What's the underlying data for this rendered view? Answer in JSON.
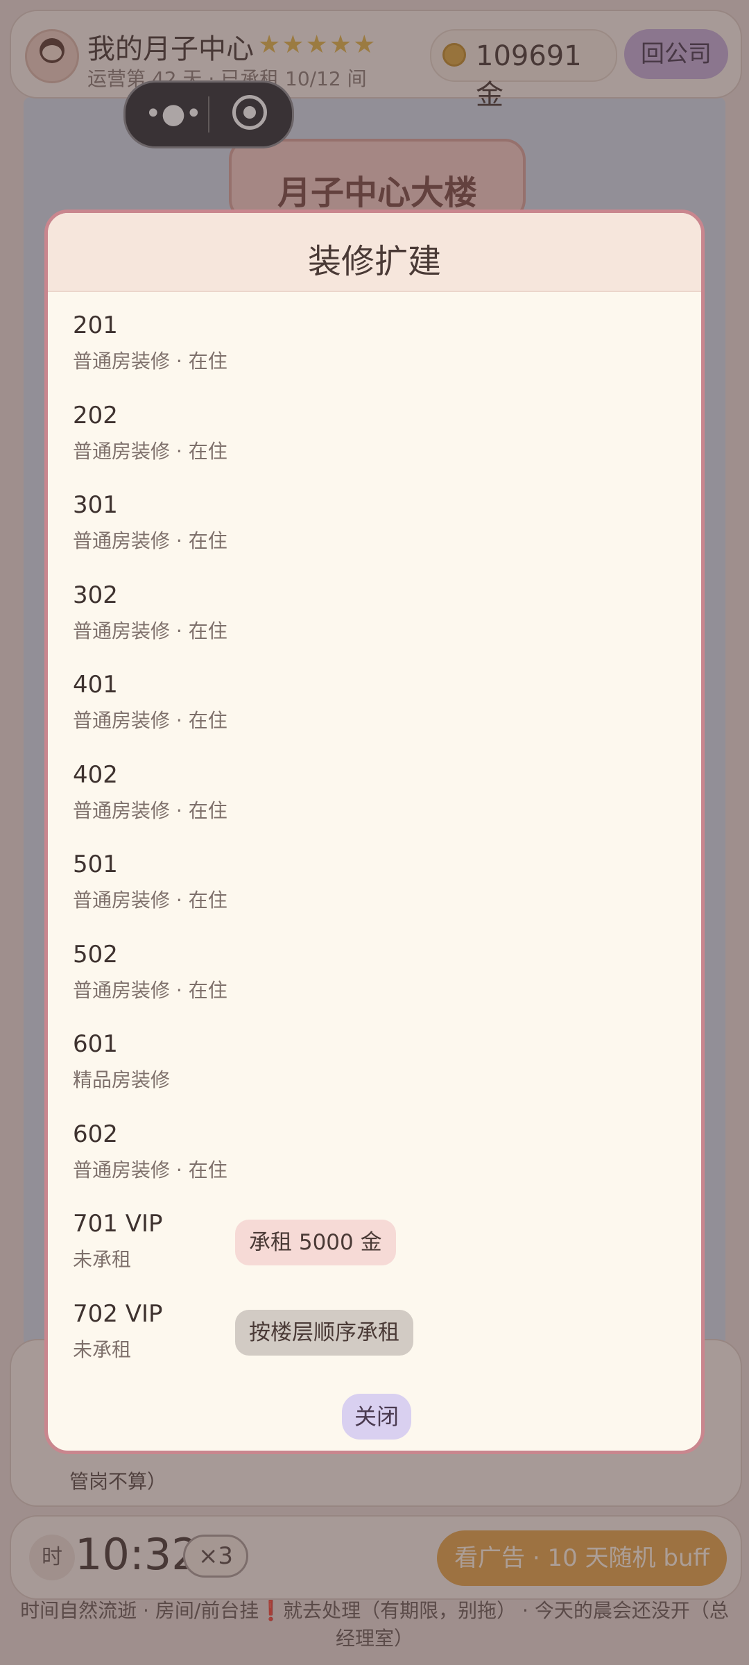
{
  "header": {
    "center_name": "我的月子中心",
    "stars": "★★★★★",
    "status_line": "运营第 42 天 · 已承租 10/12 间",
    "coins": "109691 金",
    "back_button": "回公司"
  },
  "mini_program": {
    "more_icon": "more-dots-icon",
    "close_icon": "target-close-icon"
  },
  "building": {
    "sign_title": "月子中心大楼"
  },
  "modal": {
    "title": "装修扩建",
    "rooms": [
      {
        "name": "201",
        "status": "普通房装修 · 在住"
      },
      {
        "name": "202",
        "status": "普通房装修 · 在住"
      },
      {
        "name": "301",
        "status": "普通房装修 · 在住"
      },
      {
        "name": "302",
        "status": "普通房装修 · 在住"
      },
      {
        "name": "401",
        "status": "普通房装修 · 在住"
      },
      {
        "name": "402",
        "status": "普通房装修 · 在住"
      },
      {
        "name": "501",
        "status": "普通房装修 · 在住"
      },
      {
        "name": "502",
        "status": "普通房装修 · 在住"
      },
      {
        "name": "601",
        "status": "精品房装修"
      },
      {
        "name": "602",
        "status": "普通房装修 · 在住"
      },
      {
        "name": "701 VIP",
        "status": "未承租",
        "action": "承租 5000 金"
      },
      {
        "name": "702 VIP",
        "status": "未承租",
        "action": "按楼层顺序承租"
      }
    ],
    "close_button": "关闭"
  },
  "bottom": {
    "note": "管岗不算）",
    "time_badge": "时",
    "clock": "10:32",
    "speed": "×3",
    "ad_button": "看广告 · 10 天随机 buff",
    "footer_tip": "时间自然流逝 · 房间/前台挂❗就去处理（有期限，别拖） · 今天的晨会还没开（总经理室）"
  },
  "colors": {
    "modal_border": "#c9868e",
    "modal_bg": "#fdf8ee",
    "rent_button": "#f6dad6",
    "disabled_button": "#d2cbc4",
    "close_button": "#d9d0f0",
    "ad_button": "#e3a34a",
    "back_button": "#c4a9d6"
  }
}
